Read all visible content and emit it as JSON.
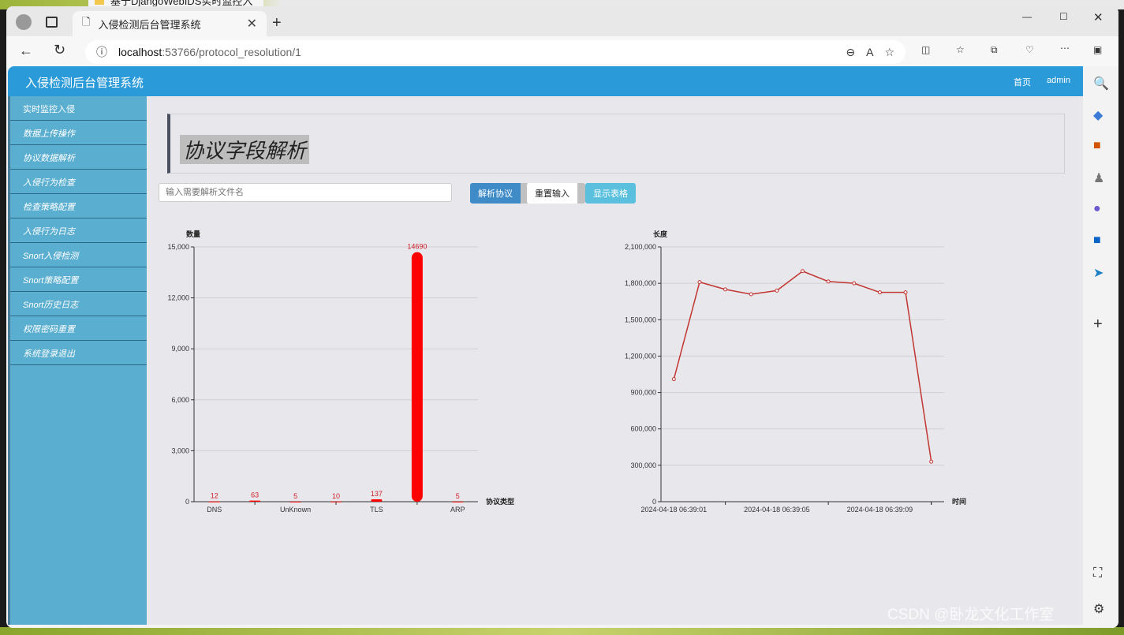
{
  "browser": {
    "tab_title": "入侵检测后台管理系统",
    "url_host": "localhost",
    "url_rest": ":53766/protocol_resolution/1",
    "background_tab": "基于DjangoWebIDS实时监控入"
  },
  "navbar": {
    "brand": "入侵检测后台管理系统",
    "links": [
      "首页",
      "admin"
    ]
  },
  "sidebar": {
    "items": [
      "实时监控入侵",
      "数据上传操作",
      "协议数据解析",
      "入侵行为检查",
      "检查策略配置",
      "入侵行为日志",
      "Snort入侵检测",
      "Snort策略配置",
      "Snort历史日志",
      "权限密码重置",
      "系统登录退出"
    ]
  },
  "main": {
    "title": "协议字段解析",
    "input_placeholder": "输入需要解析文件名",
    "buttons": {
      "parse": "解析协议",
      "reset": "重置输入",
      "show_table": "显示表格"
    }
  },
  "watermark": "CSDN @卧龙文化工作室",
  "chart_data": [
    {
      "type": "bar",
      "ylabel": "数量",
      "xlabel": "协议类型",
      "categories": [
        "DNS",
        "",
        "UnKnown",
        "",
        "TLS",
        "",
        "ARP"
      ],
      "values": [
        12,
        63,
        5,
        10,
        137,
        14690,
        5
      ],
      "ylim": [
        0,
        15000
      ],
      "yticks": [
        "0",
        "3,000",
        "6,000",
        "9,000",
        "12,000",
        "15,000"
      ],
      "color": "#ff0000",
      "grid": true
    },
    {
      "type": "line",
      "ylabel": "长度",
      "xlabel": "时间",
      "x": [
        "2024-04-18 06:39:01",
        "",
        "",
        "",
        "2024-04-18 06:39:05",
        "",
        "",
        "",
        "2024-04-18 06:39:09",
        "",
        ""
      ],
      "values": [
        1010000,
        1810000,
        1750000,
        1710000,
        1740000,
        1900000,
        1815000,
        1800000,
        1725000,
        1725000,
        330000
      ],
      "ylim": [
        0,
        2100000
      ],
      "yticks": [
        "0",
        "300,000",
        "600,000",
        "900,000",
        "1,200,000",
        "1,500,000",
        "1,800,000",
        "2,100,000"
      ],
      "color": "#c23531",
      "grid": true
    }
  ]
}
